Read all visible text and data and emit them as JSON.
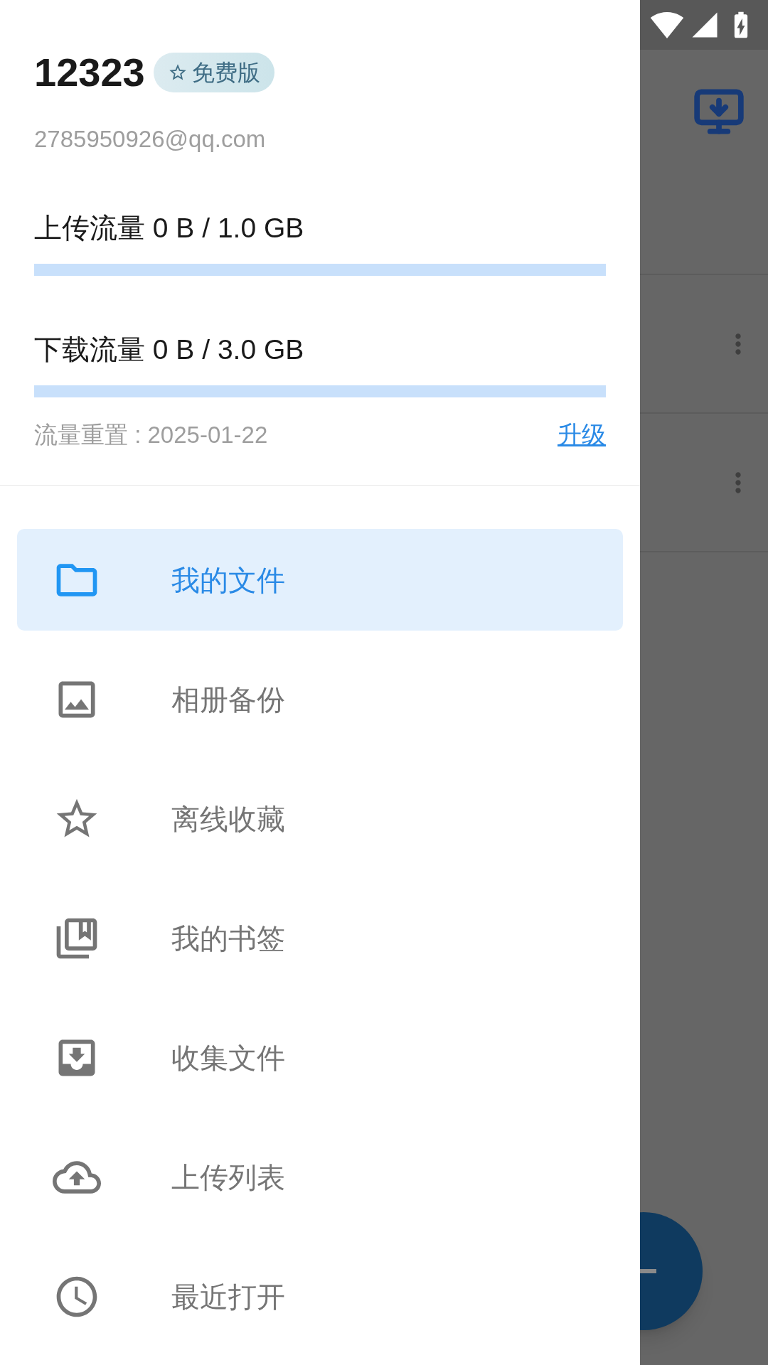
{
  "account": {
    "name": "12323",
    "plan_badge": "免费版",
    "email": "2785950926@qq.com"
  },
  "quotas": [
    {
      "label": "上传流量 0 B / 1.0 GB",
      "level": 0
    },
    {
      "label": "下载流量 0 B / 3.0 GB",
      "level": 0
    }
  ],
  "reset_date": "流量重置 : 2025-01-22",
  "upgrade_link": "升级",
  "menu": [
    {
      "label": "我的文件",
      "selected": true
    },
    {
      "label": "相册备份",
      "selected": false
    },
    {
      "label": "离线收藏",
      "selected": false
    },
    {
      "label": "我的书签",
      "selected": false
    },
    {
      "label": "收集文件",
      "selected": false
    },
    {
      "label": "上传列表",
      "selected": false
    },
    {
      "label": "最近打开",
      "selected": false
    }
  ]
}
